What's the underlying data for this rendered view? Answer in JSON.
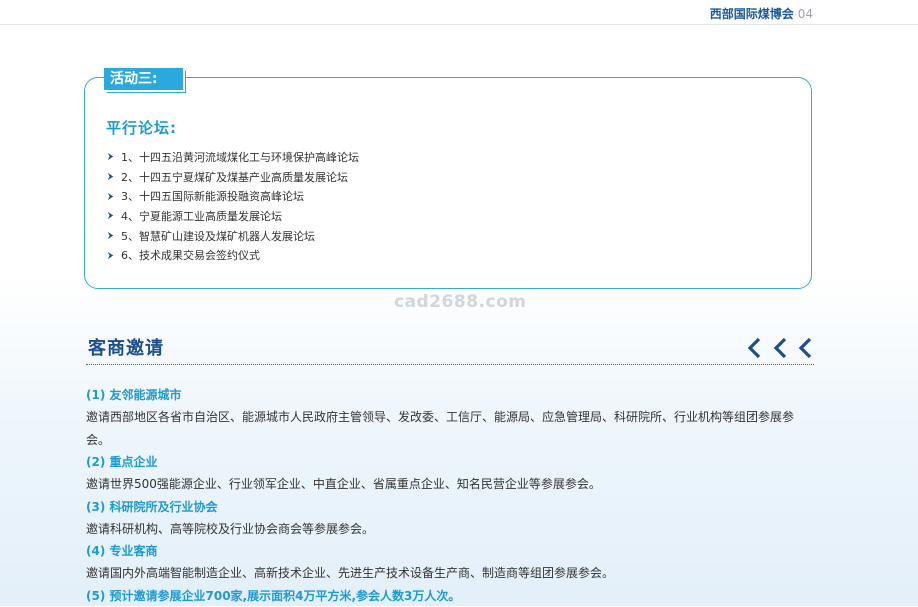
{
  "header": {
    "title": "西部国际煤博会",
    "page": "04"
  },
  "activity": {
    "badge": "活动三:",
    "subtitle": "平行论坛:",
    "items": [
      "1、十四五沿黄河流域煤化工与环境保护高峰论坛",
      "2、十四五宁夏煤矿及煤基产业高质量发展论坛",
      "3、十四五国际新能源投融资高峰论坛",
      "4、宁夏能源工业高质量发展论坛",
      "5、智慧矿山建设及煤矿机器人发展论坛",
      "6、技术成果交易会签约仪式"
    ]
  },
  "watermark": "cad2688.com",
  "invite": {
    "title": "客商邀请",
    "sections": [
      {
        "heading": "(1) 友邻能源城市",
        "body": "邀请西部地区各省市自治区、能源城市人民政府主管领导、发改委、工信厅、能源局、应急管理局、科研院所、行业机构等组团参展参会。"
      },
      {
        "heading": "(2) 重点企业",
        "body": "邀请世界500强能源企业、行业领军企业、中直企业、省属重点企业、知名民营企业等参展参会。"
      },
      {
        "heading": "(3) 科研院所及行业协会",
        "body": "邀请科研机构、高等院校及行业协会商会等参展参会。"
      },
      {
        "heading": "(4) 专业客商",
        "body": "邀请国内外高端智能制造企业、高新技术企业、先进生产技术设备生产商、制造商等组团参展参会。"
      },
      {
        "heading": "(5) 预计邀请参展企业700家,展示面积4万平方米,参会人数3万人次。",
        "body": ""
      }
    ]
  },
  "colors": {
    "accent": "#29a9dd",
    "title_blue": "#1e4f8c",
    "header_blue": "#1e5aa0"
  },
  "icons": {
    "list_bullet": "chevron-right-icon",
    "decoration": "triple-chevron-left-icon"
  }
}
